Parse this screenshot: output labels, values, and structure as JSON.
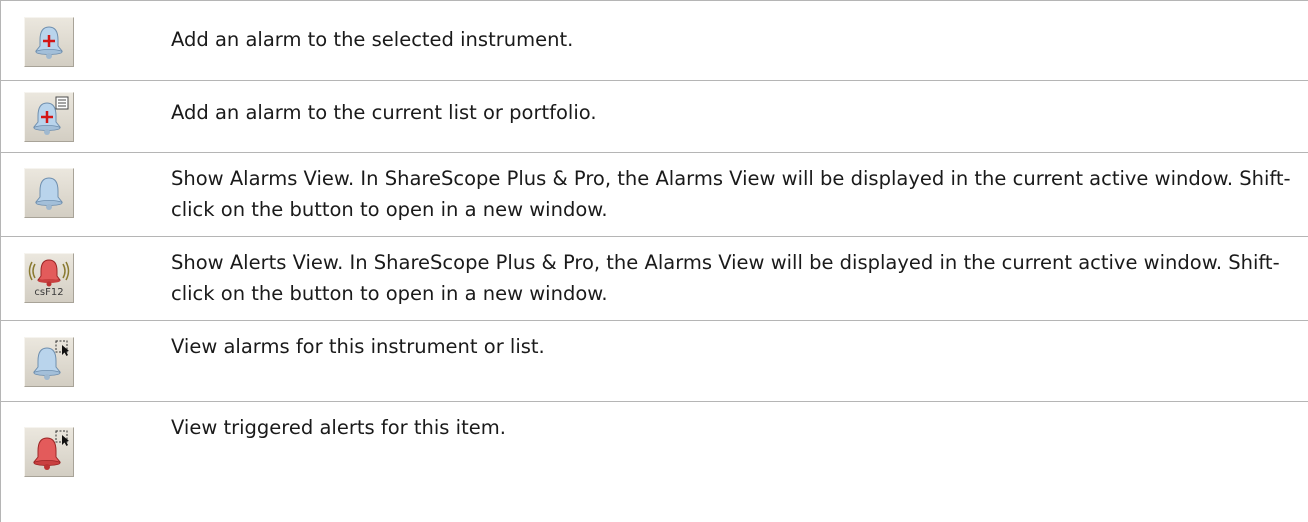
{
  "rows": [
    {
      "icon": "add-alarm-instrument-icon",
      "description": "Add an alarm to the selected instrument."
    },
    {
      "icon": "add-alarm-list-icon",
      "description": "Add an alarm to the current list or portfolio."
    },
    {
      "icon": "alarm-bell-icon",
      "description": "Show Alarms View. In ShareScope Plus & Pro, the Alarms View will be displayed in the current active window. Shift-click on the button to open in a new window."
    },
    {
      "icon": "alerts-bell-icon",
      "description": "Show Alerts View. In ShareScope Plus & Pro, the Alarms View will be displayed in the current active window. Shift-click on the button to open in a new window.",
      "shortcut": "csF12"
    },
    {
      "icon": "view-alarms-icon",
      "description": "View alarms for this instrument or list."
    },
    {
      "icon": "view-alerts-icon",
      "description": "View triggered alerts for this item."
    }
  ],
  "colors": {
    "bell_blue": "#b9d4ec",
    "bell_red": "#e35b5b",
    "plus_red": "#d31515",
    "border": "#b5b5b5"
  }
}
